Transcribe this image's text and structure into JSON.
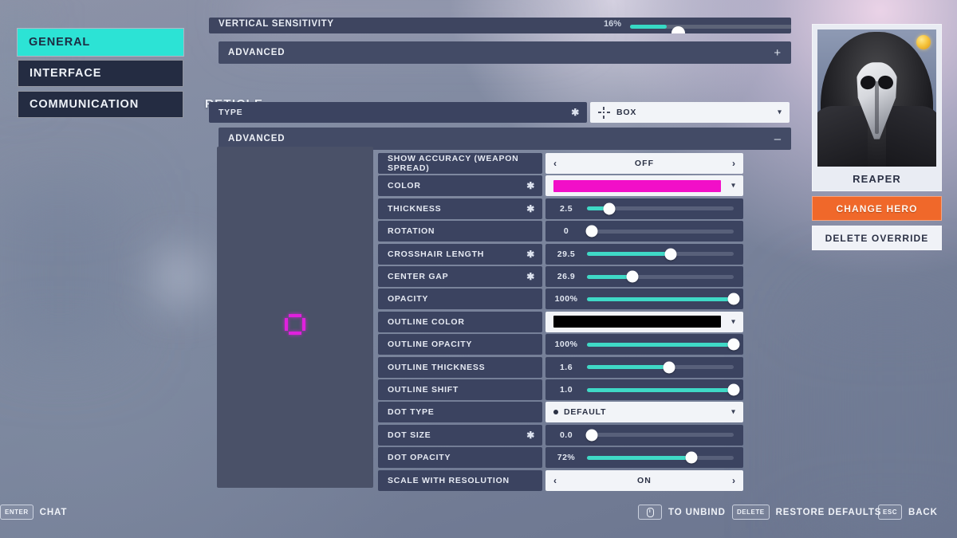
{
  "sidebar": {
    "items": [
      {
        "label": "GENERAL",
        "active": true
      },
      {
        "label": "INTERFACE",
        "active": false
      },
      {
        "label": "COMMUNICATION",
        "active": false
      }
    ]
  },
  "settings": {
    "clipped_row": {
      "label": "VERTICAL SENSITIVITY",
      "value": "16%",
      "fill_percent": 21
    },
    "sensitivity_advanced": {
      "label": "ADVANCED",
      "sign": "+"
    },
    "group_title": "RETICLE",
    "type_row": {
      "label": "TYPE",
      "value": "BOX",
      "icon": "reticle-box-icon",
      "has_star": true,
      "chevron": "⌄"
    },
    "reticle_advanced": {
      "label": "ADVANCED",
      "sign": "–"
    },
    "preview": {
      "reticle_color": "#e021dd",
      "shape": "box"
    },
    "rows": [
      {
        "name": "SHOW ACCURACY (WEAPON SPREAD)",
        "kind": "selector",
        "value": "OFF",
        "star": false
      },
      {
        "name": "COLOR",
        "kind": "color",
        "value": "#f20fc8",
        "star": true
      },
      {
        "name": "THICKNESS",
        "kind": "slider",
        "value": "2.5",
        "percent": 15,
        "star": true
      },
      {
        "name": "ROTATION",
        "kind": "slider",
        "value": "0",
        "percent": 3,
        "star": false
      },
      {
        "name": "CROSSHAIR LENGTH",
        "kind": "slider",
        "value": "29.5",
        "percent": 57,
        "star": true
      },
      {
        "name": "CENTER GAP",
        "kind": "slider",
        "value": "26.9",
        "percent": 31,
        "star": true
      },
      {
        "name": "OPACITY",
        "kind": "slider",
        "value": "100%",
        "percent": 100,
        "star": false
      },
      {
        "name": "OUTLINE COLOR",
        "kind": "color",
        "value": "#000000",
        "star": false
      },
      {
        "name": "OUTLINE OPACITY",
        "kind": "slider",
        "value": "100%",
        "percent": 100,
        "star": false
      },
      {
        "name": "OUTLINE THICKNESS",
        "kind": "slider",
        "value": "1.6",
        "percent": 56,
        "star": false
      },
      {
        "name": "OUTLINE SHIFT",
        "kind": "slider",
        "value": "1.0",
        "percent": 100,
        "star": false
      },
      {
        "name": "DOT TYPE",
        "kind": "dot-dropdown",
        "value": "DEFAULT",
        "star": false
      },
      {
        "name": "DOT SIZE",
        "kind": "slider",
        "value": "0.0",
        "percent": 3,
        "star": true
      },
      {
        "name": "DOT OPACITY",
        "kind": "slider",
        "value": "72%",
        "percent": 71,
        "star": false
      },
      {
        "name": "SCALE WITH RESOLUTION",
        "kind": "selector",
        "value": "ON",
        "star": false
      }
    ],
    "selector_arrows": {
      "left": "‹",
      "right": "›"
    }
  },
  "hero": {
    "name": "REAPER",
    "badge": "star-badge-icon",
    "change_label": "CHANGE HERO",
    "delete_label": "DELETE OVERRIDE",
    "accent": "#f0682a"
  },
  "footer": {
    "chat": {
      "key": "ENTER",
      "label": "CHAT"
    },
    "unbind": {
      "key": "mouse-icon",
      "label": "TO UNBIND"
    },
    "restore": {
      "key": "DELETE",
      "label": "RESTORE DEFAULTS"
    },
    "back": {
      "key": "ESC",
      "label": "BACK"
    }
  }
}
